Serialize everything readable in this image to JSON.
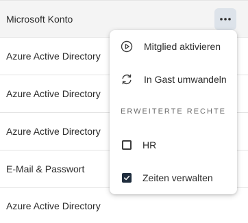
{
  "rows": [
    {
      "label": "Microsoft Konto"
    },
    {
      "label": "Azure Active Directory"
    },
    {
      "label": "Azure Active Directory"
    },
    {
      "label": "Azure Active Directory"
    },
    {
      "label": "E-Mail & Passwort"
    },
    {
      "label": "Azure Active Directory"
    }
  ],
  "more_button": {
    "icon": "more-horizontal-icon"
  },
  "menu": {
    "items": [
      {
        "label": "Mitglied aktivieren",
        "icon": "play-circle-icon"
      },
      {
        "label": "In Gast umwandeln",
        "icon": "sync-icon"
      }
    ],
    "section_title": "ERWEITERTE RECHTE",
    "checks": [
      {
        "label": "HR",
        "checked": false
      },
      {
        "label": "Zeiten verwalten",
        "checked": true
      }
    ]
  },
  "colors": {
    "row_highlight": "#f4f4f4",
    "button_background": "#dde3ea",
    "checkbox_checked": "#1f2d3d"
  }
}
